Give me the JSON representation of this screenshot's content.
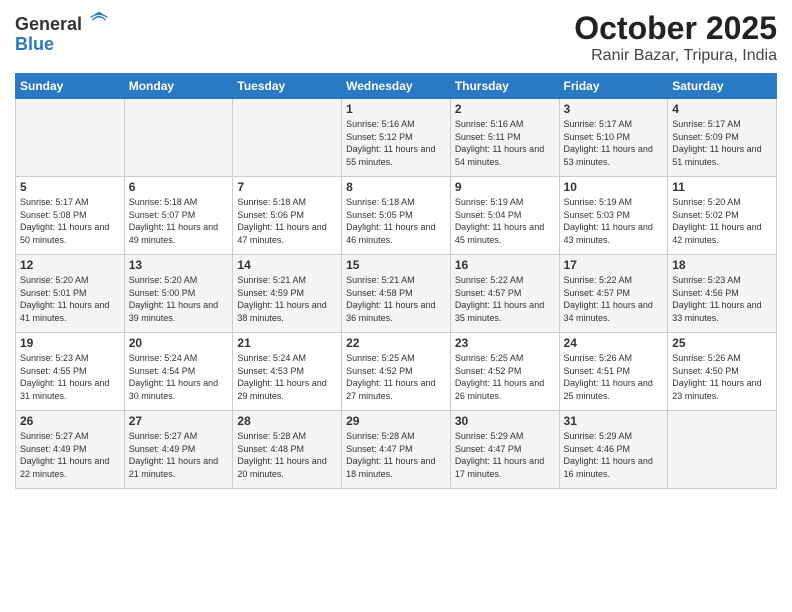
{
  "logo": {
    "line1": "General",
    "line2": "Blue"
  },
  "title": "October 2025",
  "subtitle": "Ranir Bazar, Tripura, India",
  "weekdays": [
    "Sunday",
    "Monday",
    "Tuesday",
    "Wednesday",
    "Thursday",
    "Friday",
    "Saturday"
  ],
  "weeks": [
    [
      {
        "day": "",
        "sunrise": "",
        "sunset": "",
        "daylight": ""
      },
      {
        "day": "",
        "sunrise": "",
        "sunset": "",
        "daylight": ""
      },
      {
        "day": "",
        "sunrise": "",
        "sunset": "",
        "daylight": ""
      },
      {
        "day": "1",
        "sunrise": "Sunrise: 5:16 AM",
        "sunset": "Sunset: 5:12 PM",
        "daylight": "Daylight: 11 hours and 55 minutes."
      },
      {
        "day": "2",
        "sunrise": "Sunrise: 5:16 AM",
        "sunset": "Sunset: 5:11 PM",
        "daylight": "Daylight: 11 hours and 54 minutes."
      },
      {
        "day": "3",
        "sunrise": "Sunrise: 5:17 AM",
        "sunset": "Sunset: 5:10 PM",
        "daylight": "Daylight: 11 hours and 53 minutes."
      },
      {
        "day": "4",
        "sunrise": "Sunrise: 5:17 AM",
        "sunset": "Sunset: 5:09 PM",
        "daylight": "Daylight: 11 hours and 51 minutes."
      }
    ],
    [
      {
        "day": "5",
        "sunrise": "Sunrise: 5:17 AM",
        "sunset": "Sunset: 5:08 PM",
        "daylight": "Daylight: 11 hours and 50 minutes."
      },
      {
        "day": "6",
        "sunrise": "Sunrise: 5:18 AM",
        "sunset": "Sunset: 5:07 PM",
        "daylight": "Daylight: 11 hours and 49 minutes."
      },
      {
        "day": "7",
        "sunrise": "Sunrise: 5:18 AM",
        "sunset": "Sunset: 5:06 PM",
        "daylight": "Daylight: 11 hours and 47 minutes."
      },
      {
        "day": "8",
        "sunrise": "Sunrise: 5:18 AM",
        "sunset": "Sunset: 5:05 PM",
        "daylight": "Daylight: 11 hours and 46 minutes."
      },
      {
        "day": "9",
        "sunrise": "Sunrise: 5:19 AM",
        "sunset": "Sunset: 5:04 PM",
        "daylight": "Daylight: 11 hours and 45 minutes."
      },
      {
        "day": "10",
        "sunrise": "Sunrise: 5:19 AM",
        "sunset": "Sunset: 5:03 PM",
        "daylight": "Daylight: 11 hours and 43 minutes."
      },
      {
        "day": "11",
        "sunrise": "Sunrise: 5:20 AM",
        "sunset": "Sunset: 5:02 PM",
        "daylight": "Daylight: 11 hours and 42 minutes."
      }
    ],
    [
      {
        "day": "12",
        "sunrise": "Sunrise: 5:20 AM",
        "sunset": "Sunset: 5:01 PM",
        "daylight": "Daylight: 11 hours and 41 minutes."
      },
      {
        "day": "13",
        "sunrise": "Sunrise: 5:20 AM",
        "sunset": "Sunset: 5:00 PM",
        "daylight": "Daylight: 11 hours and 39 minutes."
      },
      {
        "day": "14",
        "sunrise": "Sunrise: 5:21 AM",
        "sunset": "Sunset: 4:59 PM",
        "daylight": "Daylight: 11 hours and 38 minutes."
      },
      {
        "day": "15",
        "sunrise": "Sunrise: 5:21 AM",
        "sunset": "Sunset: 4:58 PM",
        "daylight": "Daylight: 11 hours and 36 minutes."
      },
      {
        "day": "16",
        "sunrise": "Sunrise: 5:22 AM",
        "sunset": "Sunset: 4:57 PM",
        "daylight": "Daylight: 11 hours and 35 minutes."
      },
      {
        "day": "17",
        "sunrise": "Sunrise: 5:22 AM",
        "sunset": "Sunset: 4:57 PM",
        "daylight": "Daylight: 11 hours and 34 minutes."
      },
      {
        "day": "18",
        "sunrise": "Sunrise: 5:23 AM",
        "sunset": "Sunset: 4:56 PM",
        "daylight": "Daylight: 11 hours and 33 minutes."
      }
    ],
    [
      {
        "day": "19",
        "sunrise": "Sunrise: 5:23 AM",
        "sunset": "Sunset: 4:55 PM",
        "daylight": "Daylight: 11 hours and 31 minutes."
      },
      {
        "day": "20",
        "sunrise": "Sunrise: 5:24 AM",
        "sunset": "Sunset: 4:54 PM",
        "daylight": "Daylight: 11 hours and 30 minutes."
      },
      {
        "day": "21",
        "sunrise": "Sunrise: 5:24 AM",
        "sunset": "Sunset: 4:53 PM",
        "daylight": "Daylight: 11 hours and 29 minutes."
      },
      {
        "day": "22",
        "sunrise": "Sunrise: 5:25 AM",
        "sunset": "Sunset: 4:52 PM",
        "daylight": "Daylight: 11 hours and 27 minutes."
      },
      {
        "day": "23",
        "sunrise": "Sunrise: 5:25 AM",
        "sunset": "Sunset: 4:52 PM",
        "daylight": "Daylight: 11 hours and 26 minutes."
      },
      {
        "day": "24",
        "sunrise": "Sunrise: 5:26 AM",
        "sunset": "Sunset: 4:51 PM",
        "daylight": "Daylight: 11 hours and 25 minutes."
      },
      {
        "day": "25",
        "sunrise": "Sunrise: 5:26 AM",
        "sunset": "Sunset: 4:50 PM",
        "daylight": "Daylight: 11 hours and 23 minutes."
      }
    ],
    [
      {
        "day": "26",
        "sunrise": "Sunrise: 5:27 AM",
        "sunset": "Sunset: 4:49 PM",
        "daylight": "Daylight: 11 hours and 22 minutes."
      },
      {
        "day": "27",
        "sunrise": "Sunrise: 5:27 AM",
        "sunset": "Sunset: 4:49 PM",
        "daylight": "Daylight: 11 hours and 21 minutes."
      },
      {
        "day": "28",
        "sunrise": "Sunrise: 5:28 AM",
        "sunset": "Sunset: 4:48 PM",
        "daylight": "Daylight: 11 hours and 20 minutes."
      },
      {
        "day": "29",
        "sunrise": "Sunrise: 5:28 AM",
        "sunset": "Sunset: 4:47 PM",
        "daylight": "Daylight: 11 hours and 18 minutes."
      },
      {
        "day": "30",
        "sunrise": "Sunrise: 5:29 AM",
        "sunset": "Sunset: 4:47 PM",
        "daylight": "Daylight: 11 hours and 17 minutes."
      },
      {
        "day": "31",
        "sunrise": "Sunrise: 5:29 AM",
        "sunset": "Sunset: 4:46 PM",
        "daylight": "Daylight: 11 hours and 16 minutes."
      },
      {
        "day": "",
        "sunrise": "",
        "sunset": "",
        "daylight": ""
      }
    ]
  ]
}
